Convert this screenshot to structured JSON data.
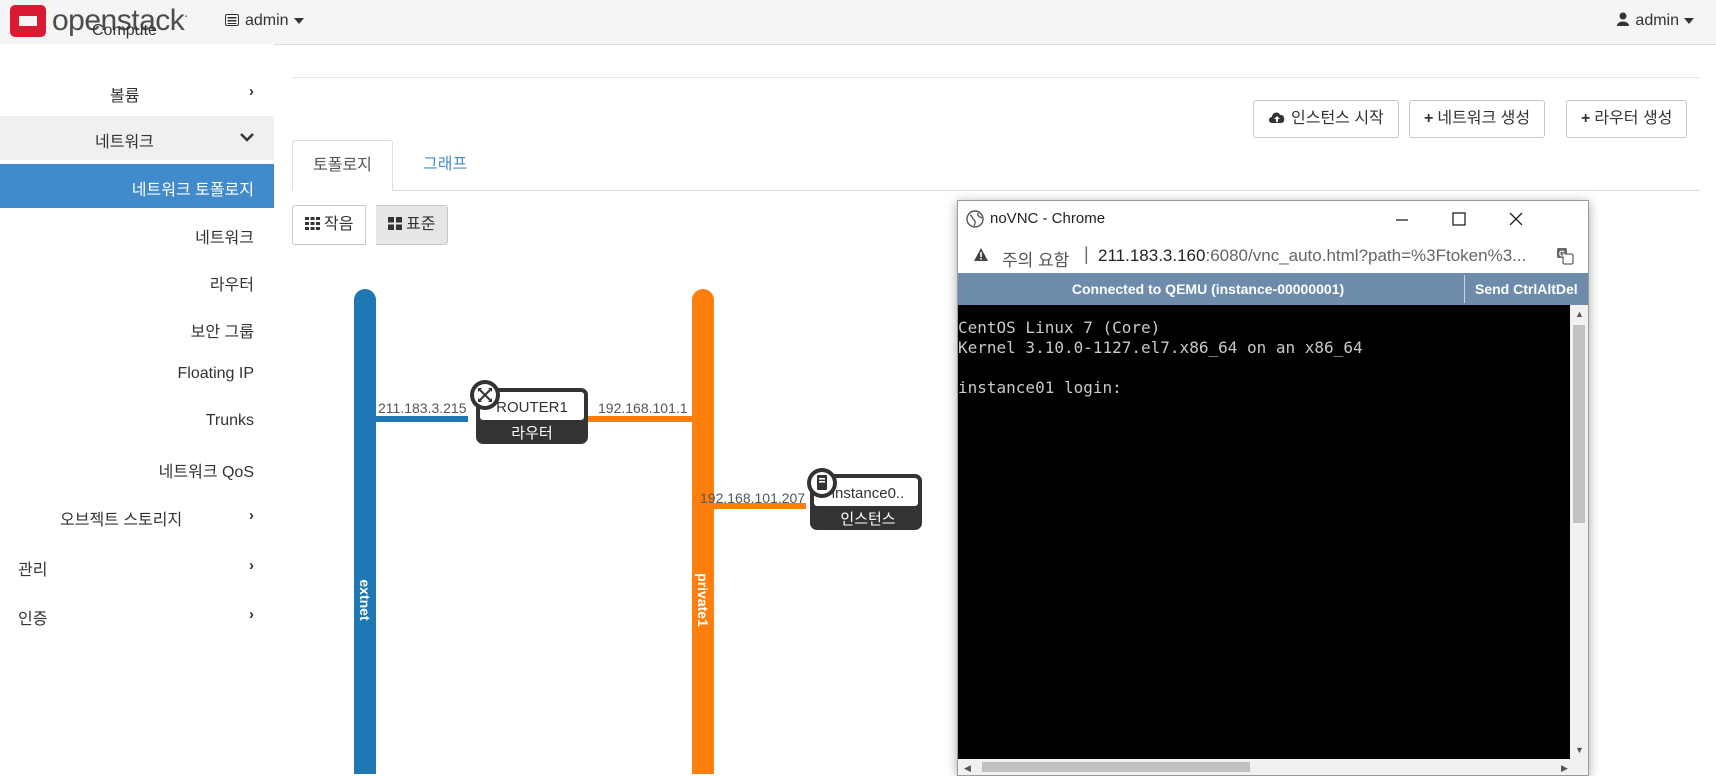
{
  "navbar": {
    "brand": "openstack",
    "project": "admin",
    "user": "admin"
  },
  "sidebar": {
    "items": [
      {
        "label": "Compute"
      },
      {
        "label": "볼륨"
      },
      {
        "label": "네트워크"
      },
      {
        "label": "네트워크 토폴로지"
      },
      {
        "label": "네트워크"
      },
      {
        "label": "라우터"
      },
      {
        "label": "보안 그룹"
      },
      {
        "label": "Floating IP"
      },
      {
        "label": "Trunks"
      },
      {
        "label": "네트워크 QoS"
      },
      {
        "label": "오브젝트 스토리지"
      },
      {
        "label": "관리"
      },
      {
        "label": "인증"
      }
    ]
  },
  "main": {
    "buttons": {
      "launch_instance": "인스턴스 시작",
      "create_network": "네트워크 생성",
      "create_router": "라우터 생성"
    },
    "tabs": [
      {
        "label": "토폴로지"
      },
      {
        "label": "그래프"
      }
    ],
    "view_toggle": {
      "small": "작음",
      "normal": "표준"
    }
  },
  "topology": {
    "networks": [
      {
        "name": "extnet",
        "color": "#1f77b4"
      },
      {
        "name": "private1",
        "color": "#ff7f0e"
      }
    ],
    "router": {
      "name": "ROUTER1",
      "type_label": "라우터",
      "left_ip": "211.183.3.215",
      "right_ip": "192.168.101.1"
    },
    "instance": {
      "name": "instance0..",
      "type_label": "인스턴스",
      "ip": "192.168.101.207"
    }
  },
  "vnc_window": {
    "title": "noVNC - Chrome",
    "warning_label": "주의 요함",
    "url_host": "211.183.3.160",
    "url_rest": ":6080/vnc_auto.html?path=%3Ftoken%3...",
    "status": "Connected to QEMU (instance-00000001)",
    "send_cad": "Send CtrlAltDel",
    "console_lines": [
      "CentOS Linux 7 (Core)",
      "Kernel 3.10.0-1127.el7.x86_64 on an x86_64",
      "",
      "instance01 login:"
    ]
  }
}
